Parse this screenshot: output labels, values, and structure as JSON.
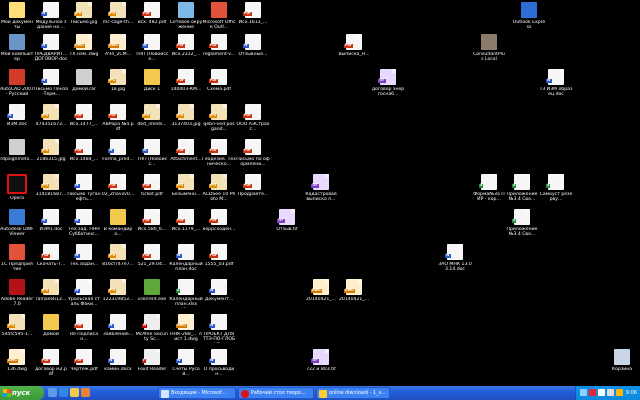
{
  "desktop": {
    "icons": [
      {
        "label": "Мои документы",
        "type": "folder2",
        "icon": "my-documents-icon"
      },
      {
        "label": "Модульное здание на ...",
        "type": "doc",
        "icon": "word-document-icon"
      },
      {
        "label": "Письмо.jpg",
        "type": "jpg",
        "icon": "jpg-image-icon"
      },
      {
        "label": "mc-cage-th...",
        "type": "jpg",
        "icon": "jpg-image-icon"
      },
      {
        "label": "исх. 482.pdf",
        "type": "pdf",
        "icon": "pdf-file-icon"
      },
      {
        "label": "Сетевое окружение",
        "type": "network",
        "icon": "network-places-icon"
      },
      {
        "label": "Microsoft Office Outl...",
        "type": "office",
        "icon": "office-outlook-icon"
      },
      {
        "label": "Исх.1613_...",
        "type": "pdf",
        "icon": "pdf-file-icon"
      },
      {
        "label": "Outlook Express",
        "type": "outlook",
        "icon": "outlook-express-icon"
      },
      {
        "label": "Мой компьютер",
        "type": "computer",
        "icon": "my-computer-icon"
      },
      {
        "label": "ПРЕДВАРИТ... ДОГОВОР.doc",
        "type": "doc",
        "icon": "word-document-icon"
      },
      {
        "label": "TX.нэм..dwg",
        "type": "dwg",
        "icon": "dwg-file-icon"
      },
      {
        "label": "АЧ4_2СМ...",
        "type": "dwg",
        "icon": "dwg-file-icon"
      },
      {
        "label": "ТНП (Новоиссе...",
        "type": "doc",
        "icon": "word-document-icon"
      },
      {
        "label": "Исх.2312_...",
        "type": "pdf",
        "icon": "pdf-file-icon"
      },
      {
        "label": "reglament-v...",
        "type": "pdf",
        "icon": "pdf-file-icon"
      },
      {
        "label": "Отзывные...",
        "type": "doc",
        "icon": "word-document-icon"
      },
      {
        "label": "Выписка_Н...",
        "type": "pdf",
        "icon": "pdf-file-icon"
      },
      {
        "label": "ConsultantPlus Local",
        "type": "cplus",
        "icon": "consultantplus-icon"
      },
      {
        "label": "AutoCAD 2007 - Русский",
        "type": "autocad",
        "icon": "autocad-icon"
      },
      {
        "label": "Письмо Пенза-Терм...",
        "type": "doc",
        "icon": "word-document-icon"
      },
      {
        "label": "Домой.rar",
        "type": "exe",
        "icon": "archive-icon"
      },
      {
        "label": "1в.jpg",
        "type": "jpg",
        "icon": "jpg-image-icon"
      },
      {
        "label": "Диск 1",
        "type": "folder",
        "icon": "folder-icon"
      },
      {
        "label": "140403-КМ...",
        "type": "pdf",
        "icon": "pdf-file-icon"
      },
      {
        "label": "Схема.pdf",
        "type": "pdf",
        "icon": "pdf-file-icon"
      },
      {
        "label": "договор энергоснаб...",
        "type": "tif",
        "icon": "tif-image-icon"
      },
      {
        "label": "ТЗ ИЗМ образец.doc",
        "type": "doc",
        "icon": "word-document-icon"
      },
      {
        "label": "ИЗМ.doc",
        "type": "doc",
        "icon": "word-document-icon"
      },
      {
        "label": "474351673...",
        "type": "jpg",
        "icon": "jpg-image-icon"
      },
      {
        "label": "Исх.1477_...",
        "type": "pdf",
        "icon": "pdf-file-icon"
      },
      {
        "label": "АВРора №4.pdf",
        "type": "pdf",
        "icon": "pdf-file-icon"
      },
      {
        "label": "ded_imeds...",
        "type": "jpg",
        "icon": "jpg-image-icon"
      },
      {
        "label": "3137403.jpg",
        "type": "jpg",
        "icon": "jpg-image-icon"
      },
      {
        "label": "qebn-ved posgand...",
        "type": "jpg",
        "icon": "jpg-image-icon"
      },
      {
        "label": "ООО АЭСтрахс...",
        "type": "pdf",
        "icon": "pdf-file-icon"
      },
      {
        "label": "rdpsignmetx...",
        "type": "exe",
        "icon": "application-icon"
      },
      {
        "label": "2186315.jpg",
        "type": "jpg",
        "icon": "jpg-image-icon"
      },
      {
        "label": "Исх.1484_...",
        "type": "pdf",
        "icon": "pdf-file-icon"
      },
      {
        "label": "Forma_pred...",
        "type": "doc",
        "icon": "word-document-icon"
      },
      {
        "label": "ТНП (Новоисс...",
        "type": "doc",
        "icon": "word-document-icon"
      },
      {
        "label": "Attachment...",
        "type": "pdf",
        "icon": "pdf-file-icon"
      },
      {
        "label": "Геодезия. Техническо...",
        "type": "pdf",
        "icon": "pdf-file-icon"
      },
      {
        "label": "Письмо по оформлени...",
        "type": "pdf",
        "icon": "pdf-file-icon"
      },
      {
        "label": "Opera",
        "type": "opera",
        "icon": "opera-icon"
      },
      {
        "label": "314181687...",
        "type": "jpg",
        "icon": "jpg-image-icon"
      },
      {
        "label": "Письмо Туганефть...",
        "type": "doc",
        "icon": "word-document-icon"
      },
      {
        "label": "02_Zhaviiv0...",
        "type": "pdf",
        "icon": "pdf-file-icon"
      },
      {
        "label": "ticket.pdf",
        "type": "pdf",
        "icon": "pdf-file-icon"
      },
      {
        "label": "Безымянн...",
        "type": "jpg",
        "icon": "jpg-image-icon"
      },
      {
        "label": "ACDSee 10 Photo M...",
        "type": "jpg",
        "icon": "acdsee-icon"
      },
      {
        "label": "Продраете...",
        "type": "pdf",
        "icon": "pdf-file-icon"
      },
      {
        "label": "Кадастровая выписка п...",
        "type": "tif",
        "icon": "tif-image-icon"
      },
      {
        "label": "Форма№3а ПИР - кор...",
        "type": "xls",
        "icon": "excel-file-icon"
      },
      {
        "label": "Приложение №3.4 Сво...",
        "type": "xls",
        "icon": "excel-file-icon"
      },
      {
        "label": "Самоуст резерву...",
        "type": "xls",
        "icon": "excel-file-icon"
      },
      {
        "label": "Autodesk DWF Viewer",
        "type": "dwfv",
        "icon": "dwf-viewer-icon"
      },
      {
        "label": "ИЗМ1.doc",
        "type": "doc",
        "icon": "word-document-icon"
      },
      {
        "label": "Тех.зад. ПНН Субботинс...",
        "type": "doc",
        "icon": "word-document-icon"
      },
      {
        "label": "В командиро...",
        "type": "folder",
        "icon": "folder-icon"
      },
      {
        "label": "Исх.580_б...",
        "type": "pdf",
        "icon": "pdf-file-icon"
      },
      {
        "label": "Исх.1179_...",
        "type": "pdf",
        "icon": "pdf-file-icon"
      },
      {
        "label": "коррсходен...",
        "type": "pdf",
        "icon": "pdf-file-icon"
      },
      {
        "label": "Отзыв.tif",
        "type": "tif",
        "icon": "tif-image-icon"
      },
      {
        "label": "Приложение №3.4 Сво...",
        "type": "xls",
        "icon": "excel-file-icon"
      },
      {
        "label": "1С Предприятие",
        "type": "office",
        "icon": "1c-enterprise-icon"
      },
      {
        "label": "Скачать-Т...",
        "type": "pdf",
        "icon": "pdf-file-icon"
      },
      {
        "label": "Тех.задан...",
        "type": "doc",
        "icon": "word-document-icon"
      },
      {
        "label": "816cf747e7...",
        "type": "jpg",
        "icon": "jpg-image-icon"
      },
      {
        "label": "521_29.04...",
        "type": "pdf",
        "icon": "pdf-file-icon"
      },
      {
        "label": "Календарный план.doc",
        "type": "doc",
        "icon": "word-document-icon"
      },
      {
        "label": "1555_03.pdf",
        "type": "pdf",
        "icon": "pdf-file-icon"
      },
      {
        "label": "ЗАО МНК 13.03.14.doc",
        "type": "doc",
        "icon": "word-document-icon"
      },
      {
        "label": "Adobe Reader 7.0",
        "type": "acrobat",
        "icon": "adobe-reader-icon"
      },
      {
        "label": "ramael4i12...",
        "type": "jpg",
        "icon": "jpg-image-icon"
      },
      {
        "label": "Уральская сталь Фоки...",
        "type": "doc",
        "icon": "word-document-icon"
      },
      {
        "label": "122319853...",
        "type": "jpg",
        "icon": "jpg-image-icon"
      },
      {
        "label": "uTorrent.exe",
        "type": "utorrent",
        "icon": "utorrent-icon"
      },
      {
        "label": "Календарный план.xlsx (4)...",
        "type": "xls",
        "icon": "excel-file-icon"
      },
      {
        "label": "Документ...",
        "type": "doc",
        "icon": "word-document-icon"
      },
      {
        "label": "20140421_...",
        "type": "dwg",
        "icon": "dwg-file-icon"
      },
      {
        "label": "20140421_...",
        "type": "dwg",
        "icon": "dwg-file-icon"
      },
      {
        "label": "5d5fc595-1...",
        "type": "jpg",
        "icon": "jpg-image-icon"
      },
      {
        "label": "Домой",
        "type": "folder",
        "icon": "folder-icon"
      },
      {
        "label": "Re Подписан...",
        "type": "pdf",
        "icon": "pdf-file-icon"
      },
      {
        "label": "Заявление...",
        "type": "doc",
        "icon": "word-document-icon"
      },
      {
        "label": "McAfee Security Sc...",
        "type": "mcafee",
        "icon": "mcafee-icon"
      },
      {
        "label": "ННК-288_... лист 1.dwg",
        "type": "dwg",
        "icon": "dwg-file-icon"
      },
      {
        "label": "ПРОЕКТ ДЛЯ ТТЭ-ПО-ГЛОБУС...",
        "type": "doc",
        "icon": "word-document-icon"
      },
      {
        "label": "136.dwg",
        "type": "dwg",
        "icon": "dwg-file-icon"
      },
      {
        "label": "договор м2.pdf",
        "type": "pdf",
        "icon": "pdf-file-icon"
      },
      {
        "label": "Чертеж.pdf",
        "type": "pdf",
        "icon": "pdf-file-icon"
      },
      {
        "label": "камин.docx",
        "type": "doc",
        "icon": "word-document-icon"
      },
      {
        "label": "Foxit Reader",
        "type": "foxit",
        "icon": "foxit-reader-icon"
      },
      {
        "label": "Счеты Русой...",
        "type": "doc",
        "icon": "word-document-icon"
      },
      {
        "label": "О просьводин...",
        "type": "doc",
        "icon": "word-document-icon"
      },
      {
        "label": "722 и 803.tif",
        "type": "tif",
        "icon": "tif-image-icon"
      },
      {
        "label": "Корзина",
        "type": "recycle",
        "icon": "recycle-bin-icon"
      }
    ]
  },
  "taskbar": {
    "start_label": "пуск",
    "quick_launch": [
      "show-desktop-icon",
      "ie-icon",
      "outlook-icon",
      "media-icon"
    ],
    "buttons": [
      {
        "label": "Входящие - Microsof...",
        "icon": "outlook-icon",
        "color": "#d3e6ff"
      },
      {
        "label": "Рабочий стол творо...",
        "icon": "opera-icon",
        "color": "#d11"
      },
      {
        "label": "online diwnloadi - 1_э...",
        "icon": "word-icon",
        "color": "#ffcc33"
      }
    ],
    "tray_icons": [
      "network-icon",
      "antivirus-icon",
      "lang-icon",
      "volume-icon",
      "update-icon"
    ],
    "clock": "9:06"
  },
  "colors": {
    "desktop_bg": "#000000",
    "taskbar": "#245edb",
    "start": "#3c9a37",
    "tray": "#0d8adb"
  }
}
